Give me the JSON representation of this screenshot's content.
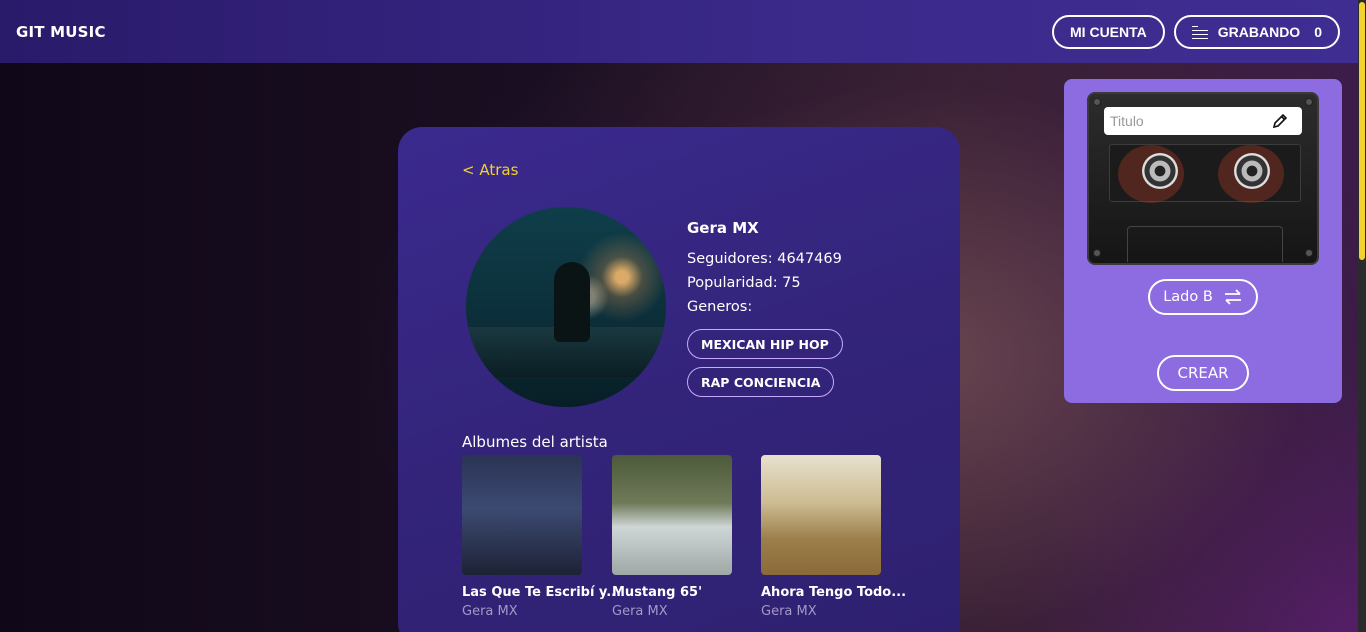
{
  "header": {
    "brand": "GIT MUSIC",
    "account_label": "MI CUENTA",
    "recording_label": "GRABANDO",
    "recording_count": "0"
  },
  "artist": {
    "back_label": "< Atras",
    "name": "Gera MX",
    "followers": "Seguidores: 4647469",
    "popularity": "Popularidad: 75",
    "genres_label": "Generos:",
    "genres": [
      "MEXICAN HIP HOP",
      "RAP CONCIENCIA"
    ]
  },
  "albums": {
    "title": "Albumes del artista",
    "items": [
      {
        "name": "Las Que Te Escribí y...",
        "artist": "Gera MX"
      },
      {
        "name": "Mustang 65'",
        "artist": "Gera MX"
      },
      {
        "name": "Ahora Tengo Todo...",
        "artist": "Gera MX"
      }
    ]
  },
  "recorder": {
    "title_placeholder": "Titulo",
    "side_label": "Lado B",
    "create_label": "CREAR"
  },
  "colors": {
    "accent": "#f2d22e",
    "panel": "#8d6be0",
    "card": "#33247a"
  }
}
